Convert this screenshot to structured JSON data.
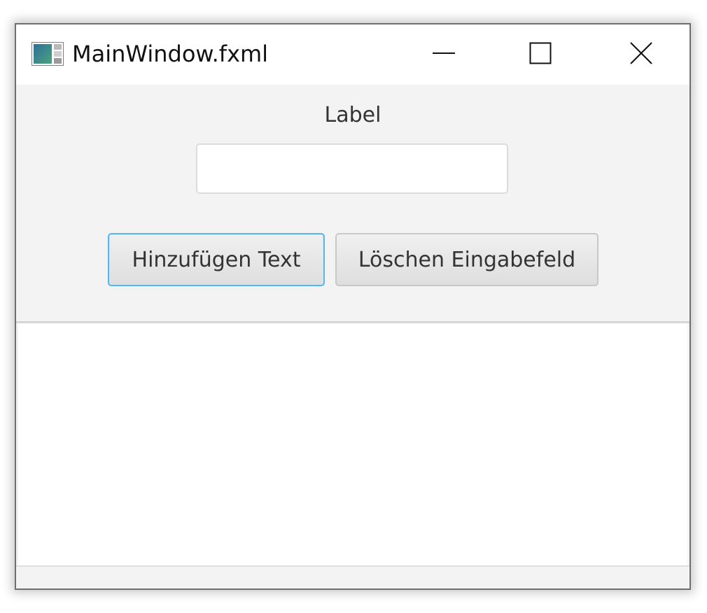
{
  "window": {
    "title": "MainWindow.fxml",
    "app_icon": "fxml-app-icon",
    "controls": {
      "minimize_icon": "minimize-icon",
      "maximize_icon": "maximize-icon",
      "close_icon": "close-icon"
    }
  },
  "form": {
    "label": "Label",
    "input_value": "",
    "input_placeholder": ""
  },
  "buttons": {
    "add_label": "Hinzufügen Text",
    "clear_label": "Löschen Eingabefeld"
  },
  "list": {
    "items": []
  },
  "colors": {
    "focus_border": "#59b4e8",
    "background": "#f3f3f3",
    "surface": "#ffffff"
  }
}
